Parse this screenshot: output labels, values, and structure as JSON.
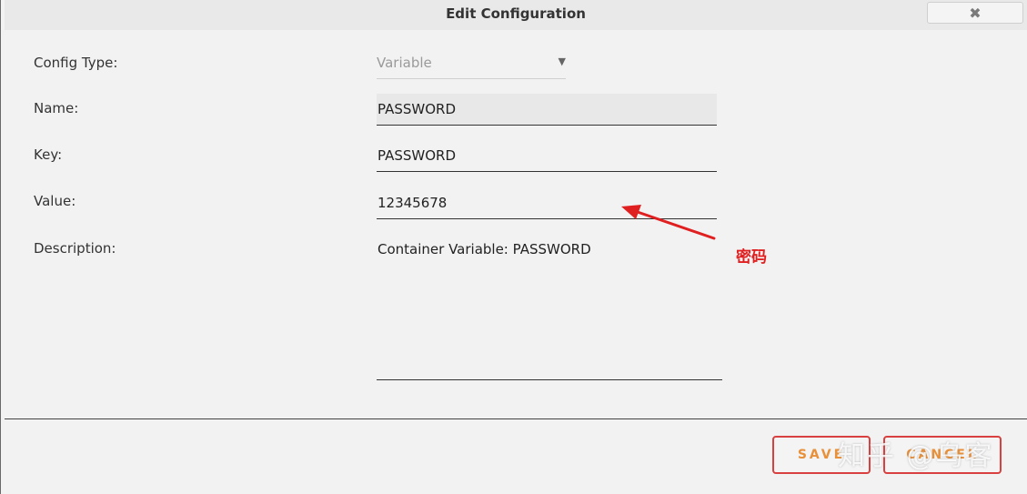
{
  "dialog": {
    "title": "Edit Configuration",
    "close_glyph": "✖"
  },
  "form": {
    "config_type": {
      "label": "Config Type:",
      "value": "Variable",
      "caret": "▼"
    },
    "name": {
      "label": "Name:",
      "value": "PASSWORD"
    },
    "key": {
      "label": "Key:",
      "value": "PASSWORD"
    },
    "value": {
      "label": "Value:",
      "value": "12345678"
    },
    "description": {
      "label": "Description:",
      "value": "Container Variable: PASSWORD"
    }
  },
  "buttons": {
    "save": "SAVE",
    "cancel": "CANCEL"
  },
  "annotation": {
    "text": "密码",
    "color": "#e02020"
  },
  "watermark": {
    "text": "知乎 @乌客"
  },
  "colors": {
    "button_border": "#d94040",
    "button_text": "#e8903a"
  }
}
